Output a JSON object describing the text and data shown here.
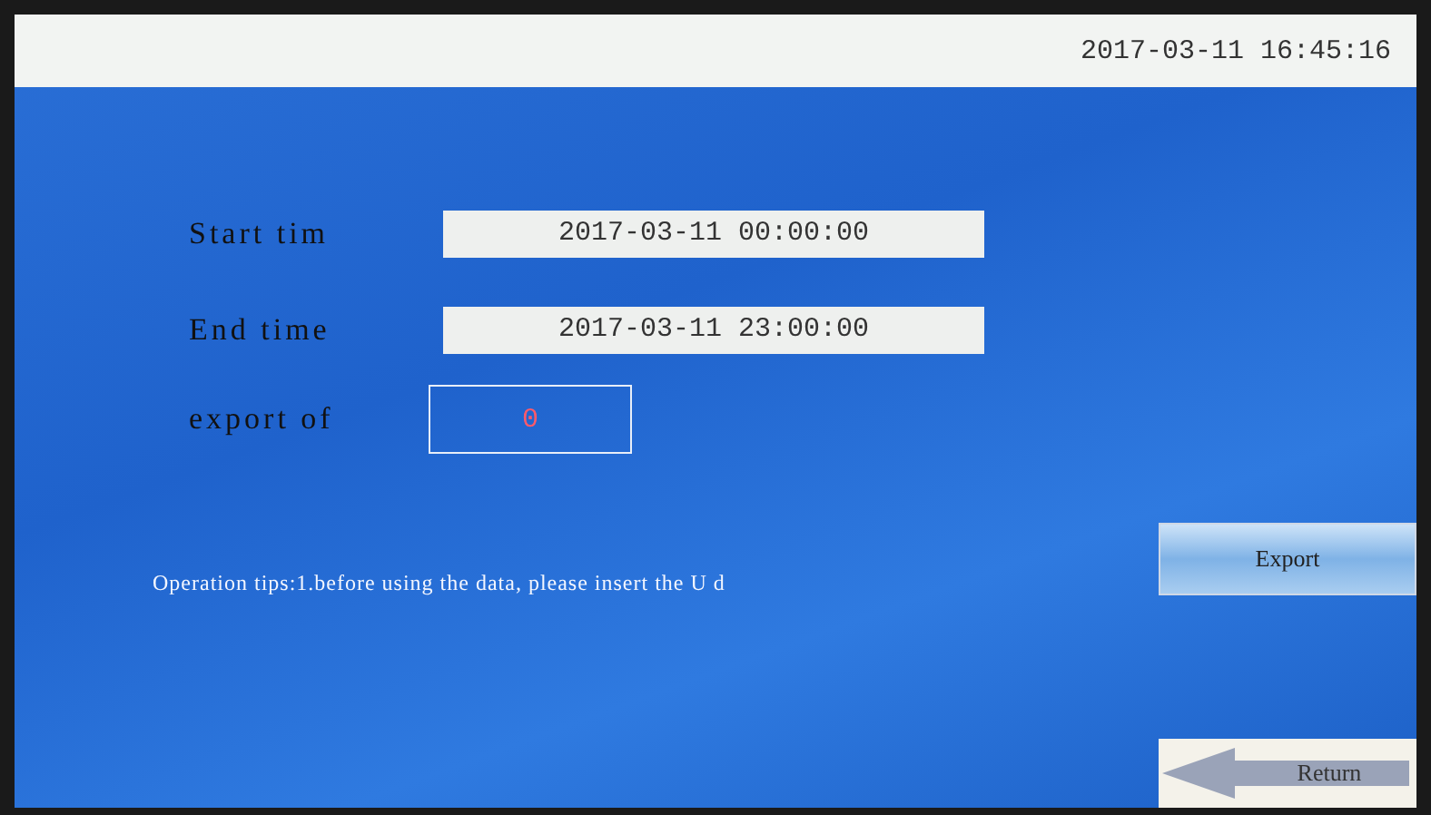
{
  "header": {
    "datetime": "2017-03-11 16:45:16"
  },
  "form": [
    {
      "kind": "field",
      "label": "Start tim",
      "value": "2017-03-11 00:00:00"
    },
    {
      "kind": "field",
      "label": "End time",
      "value": "2017-03-11 23:00:00"
    },
    {
      "kind": "counter",
      "label": "export of",
      "value": "0"
    }
  ],
  "tips": "Operation tips:1.before using the data, please insert the U d",
  "buttons": [
    {
      "kind": "export",
      "label": "Export"
    },
    {
      "kind": "return",
      "label": "Return"
    }
  ]
}
